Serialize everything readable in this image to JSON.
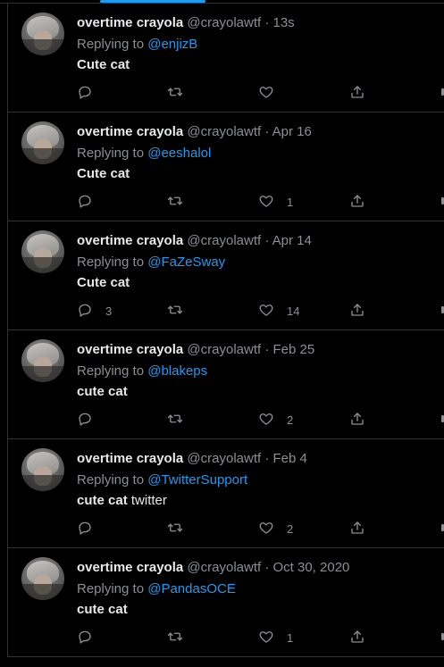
{
  "tweets": [
    {
      "name": "overtime crayola",
      "handle": "@crayolawtf",
      "time": "13s",
      "reply_label": "Replying to",
      "mention": "@enjizB",
      "bold": "Cute cat",
      "text": "",
      "replies": "",
      "likes": ""
    },
    {
      "name": "overtime crayola",
      "handle": "@crayolawtf",
      "time": "Apr 16",
      "reply_label": "Replying to",
      "mention": "@eeshalol",
      "bold": "Cute cat",
      "text": "",
      "replies": "",
      "likes": "1"
    },
    {
      "name": "overtime crayola",
      "handle": "@crayolawtf",
      "time": "Apr 14",
      "reply_label": "Replying to",
      "mention": "@FaZeSway",
      "bold": "Cute cat",
      "text": "",
      "replies": "3",
      "likes": "14"
    },
    {
      "name": "overtime crayola",
      "handle": "@crayolawtf",
      "time": "Feb 25",
      "reply_label": "Replying to",
      "mention": "@blakeps",
      "bold": "cute cat",
      "text": "",
      "replies": "",
      "likes": "2"
    },
    {
      "name": "overtime crayola",
      "handle": "@crayolawtf",
      "time": "Feb 4",
      "reply_label": "Replying to",
      "mention": "@TwitterSupport",
      "bold": "cute cat",
      "text": " twitter",
      "replies": "",
      "likes": "2"
    },
    {
      "name": "overtime crayola",
      "handle": "@crayolawtf",
      "time": "Oct 30, 2020",
      "reply_label": "Replying to",
      "mention": "@PandasOCE",
      "bold": "cute cat",
      "text": "",
      "replies": "",
      "likes": "1"
    }
  ],
  "icons": {
    "reply": "reply-icon",
    "retweet": "retweet-icon",
    "like": "heart-icon",
    "share": "share-icon"
  },
  "colors": {
    "background": "#000000",
    "accent": "#1d9bf0",
    "muted": "#8b8f93",
    "text": "#e7e9ea",
    "divider": "#2f3336"
  }
}
